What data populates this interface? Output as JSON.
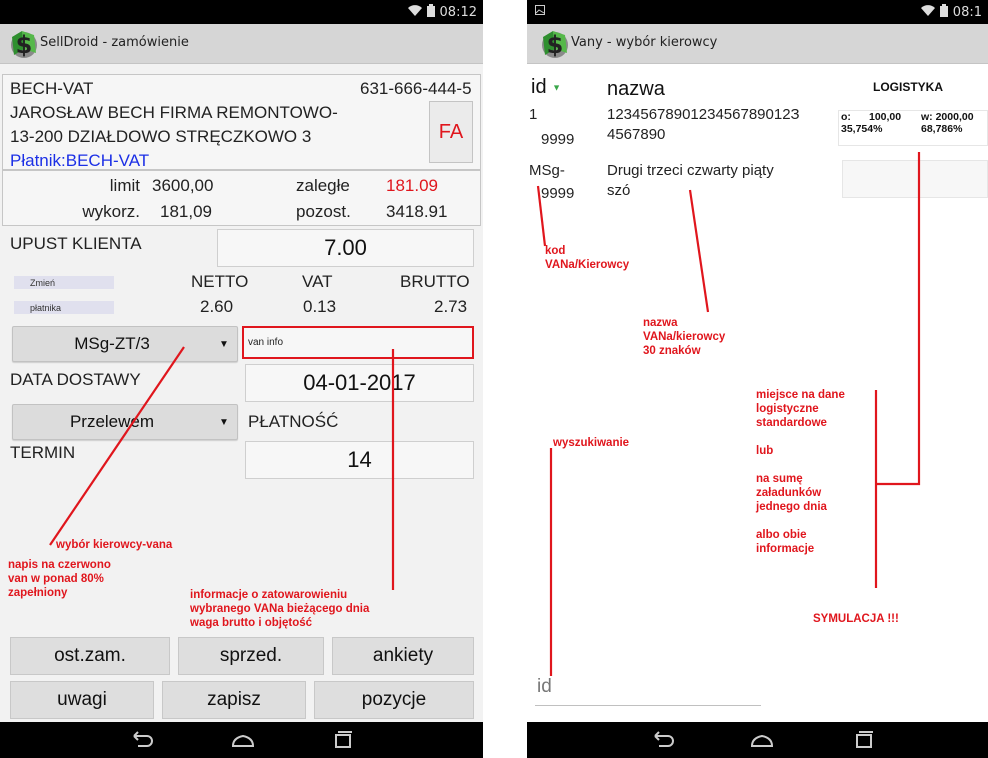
{
  "left": {
    "status": {
      "time": "08:12"
    },
    "title": "SellDroid - zamówienie",
    "client": {
      "code": "BECH-VAT",
      "phone": "631-666-444-5",
      "name": "JAROSŁAW BECH FIRMA REMONTOWO-",
      "address": "13-200 DZIAŁDOWO STRĘCZKOWO 3",
      "payer": "Płatnik:BECH-VAT",
      "fa_label": "FA"
    },
    "limits": {
      "limit_label": "limit",
      "limit_value": "3600,00",
      "overdue_label": "zaległe",
      "overdue_value": "181.09",
      "used_label": "wykorz.",
      "used_value": "181,09",
      "remaining_label": "pozost.",
      "remaining_value": "3418.91"
    },
    "discount": {
      "label": "UPUST KLIENTA",
      "value": "7.00"
    },
    "totals": {
      "change_label": "Zmień",
      "payer_label": "płatnika",
      "netto_label": "NETTO",
      "vat_label": "VAT",
      "brutto_label": "BRUTTO",
      "netto_value": "2.60",
      "vat_value": "0.13",
      "brutto_value": "2.73"
    },
    "van": {
      "selected": "MSg-ZT/3",
      "info_placeholder": "van info"
    },
    "delivery": {
      "label": "DATA DOSTAWY",
      "value": "04-01-2017"
    },
    "payment": {
      "method": "Przelewem",
      "label": "PŁATNOŚĆ"
    },
    "term": {
      "label": "TERMIN",
      "value": "14"
    },
    "buttons": {
      "last_orders": "ost.zam.",
      "sales": "sprzed.",
      "surveys": "ankiety",
      "notes": "uwagi",
      "save": "zapisz",
      "items": "pozycje"
    },
    "annotations": {
      "van_choice": "wybór kierowcy-vana",
      "red_text": "napis na czerwono\nvan w ponad 80%\nzapełniony",
      "info": "informacje o zatowarowieniu\nwybranego VANa bieżącego dnia\nwaga brutto i objętość"
    }
  },
  "right": {
    "status": {
      "time": "08:1"
    },
    "title": "Vany - wybór kierowcy",
    "table": {
      "col_id": "id",
      "col_name": "nazwa",
      "sort_indicator": "▼",
      "logistics_header": "LOGISTYKA",
      "rows": [
        {
          "id_top": "1",
          "id_bottom": "9999",
          "name_line1": "1234567890123456789012З",
          "name_line2": "4567890",
          "logi_o": "o:",
          "logi_o_value": "100,00",
          "logi_w": "w: 2000,00",
          "logi_pct1": "35,754%",
          "logi_pct2": "68,786%"
        },
        {
          "id_top": "MSg-",
          "id_bottom": "9999",
          "name_line1": "Drugi trzeci czwarty piąty",
          "name_line2": "szó"
        }
      ]
    },
    "search_placeholder": "id",
    "annotations": {
      "code": "kod\nVANa/Kierowcy",
      "name": "nazwa\nVANa/kierowcy\n30 znaków",
      "search": "wyszukiwanie",
      "logistics": "miejsce na dane\nlogistyczne\nstandardowe\n\nlub\n\nna sumę\nzaładunków\njednego dnia\n\nalbo obie\ninformacje",
      "simulation": "SYMULACJA !!!"
    }
  }
}
